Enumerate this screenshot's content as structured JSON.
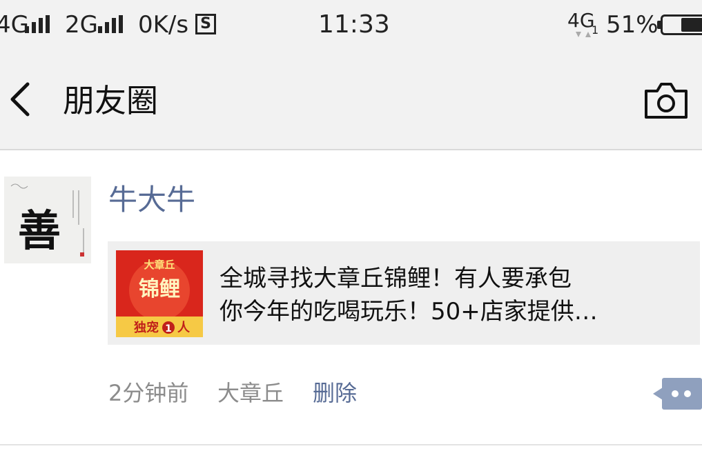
{
  "status_bar": {
    "network1": "4G",
    "network2": "2G",
    "speed": "0K/s",
    "time": "11:33",
    "network3": "4G",
    "battery": "51%",
    "battery_level": 0.51
  },
  "nav": {
    "title": "朋友圈"
  },
  "post": {
    "author": "牛大牛",
    "avatar_text": "善",
    "link": {
      "line1": "全城寻找大章丘锦鲤！有人要承包",
      "line2": "你今年的吃喝玩乐！50+店家提供…",
      "thumb_top": "大章丘",
      "thumb_main": "锦鲤",
      "thumb_bottom": "独宠",
      "thumb_badge": "1",
      "thumb_suffix": "人"
    },
    "time": "2分钟前",
    "location": "大章丘",
    "delete_label": "删除"
  },
  "colors": {
    "link_blue": "#576b95",
    "meta_gray": "#8c8c8c",
    "bar_bg": "#f2f2f2"
  }
}
